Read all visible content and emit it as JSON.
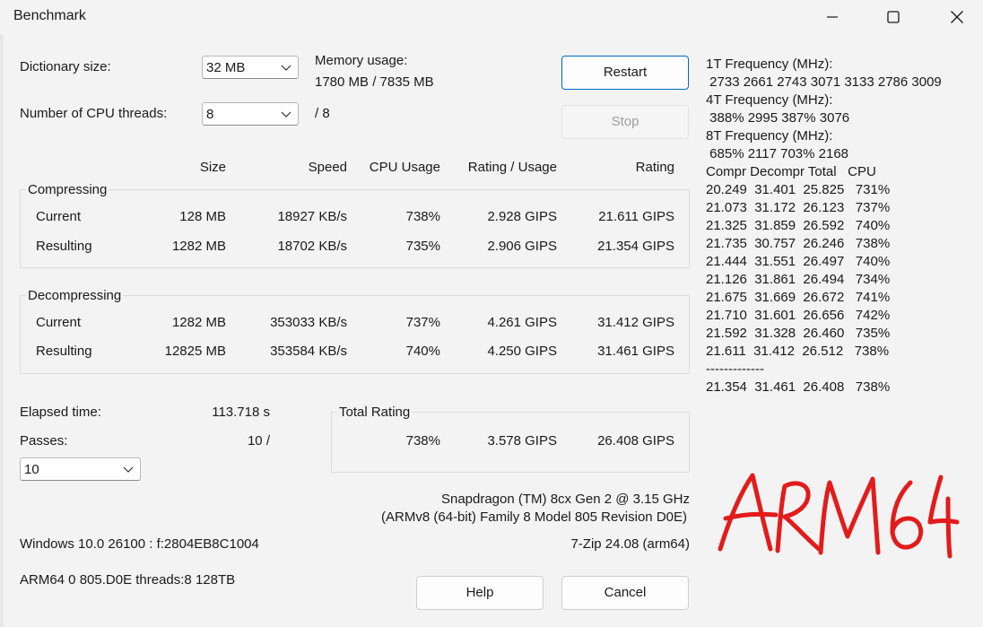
{
  "window": {
    "title": "Benchmark"
  },
  "dictionary": {
    "label": "Dictionary size:",
    "value": "32 MB"
  },
  "memory": {
    "label": "Memory usage:",
    "value": "1780 MB / 7835 MB"
  },
  "threads": {
    "label": "Number of CPU threads:",
    "value": "8",
    "max": "/ 8"
  },
  "buttons": {
    "restart": "Restart",
    "stop": "Stop",
    "help": "Help",
    "cancel": "Cancel"
  },
  "columns": [
    "Size",
    "Speed",
    "CPU Usage",
    "Rating / Usage",
    "Rating"
  ],
  "compressing": {
    "title": "Compressing",
    "rows": [
      {
        "label": "Current",
        "size": "128 MB",
        "speed": "18927 KB/s",
        "cpu": "738%",
        "rpu": "2.928 GIPS",
        "rating": "21.611 GIPS"
      },
      {
        "label": "Resulting",
        "size": "1282 MB",
        "speed": "18702 KB/s",
        "cpu": "735%",
        "rpu": "2.906 GIPS",
        "rating": "21.354 GIPS"
      }
    ]
  },
  "decompressing": {
    "title": "Decompressing",
    "rows": [
      {
        "label": "Current",
        "size": "1282 MB",
        "speed": "353033 KB/s",
        "cpu": "737%",
        "rpu": "4.261 GIPS",
        "rating": "31.412 GIPS"
      },
      {
        "label": "Resulting",
        "size": "12825 MB",
        "speed": "353584 KB/s",
        "cpu": "740%",
        "rpu": "4.250 GIPS",
        "rating": "31.461 GIPS"
      }
    ]
  },
  "elapsed": {
    "label": "Elapsed time:",
    "value": "113.718 s"
  },
  "passes": {
    "label": "Passes:",
    "value": "10 /",
    "select": "10"
  },
  "total": {
    "title": "Total Rating",
    "cpu": "738%",
    "rpu": "3.578 GIPS",
    "rating": "26.408 GIPS"
  },
  "cpu_info": {
    "line1": "Snapdragon (TM) 8cx Gen 2 @ 3.15 GHz",
    "line2": "(ARMv8 (64-bit) Family 8 Model 805 Revision D0E)"
  },
  "system": {
    "windows": "Windows 10.0 26100 :  f:2804EB8C1004",
    "version": "7-Zip 24.08 (arm64)",
    "arch": "ARM64 0 805.D0E threads:8 128TB"
  },
  "right_log": [
    "1T Frequency (MHz):",
    " 2733 2661 2743 3071 3133 2786 3009",
    "4T Frequency (MHz):",
    " 388% 2995 387% 3076",
    "8T Frequency (MHz):",
    " 685% 2117 703% 2168",
    "Compr Decompr Total   CPU",
    "20.249  31.401  25.825   731%",
    "21.073  31.172  26.123   737%",
    "21.325  31.859  26.592   740%",
    "21.735  30.757  26.246   738%",
    "21.444  31.551  26.497   740%",
    "21.126  31.861  26.494   734%",
    "21.675  31.669  26.672   741%",
    "21.710  31.601  26.656   742%",
    "21.592  31.328  26.460   735%",
    "21.611  31.412  26.512   738%",
    "-------------",
    "21.354  31.461  26.408   738%"
  ],
  "annotation": {
    "text": "ARM64",
    "color": "#e31b1b"
  },
  "icons": {
    "minimize": "minimize-icon",
    "maximize": "maximize-icon",
    "close": "close-icon",
    "chevron": "chevron-down-icon"
  }
}
